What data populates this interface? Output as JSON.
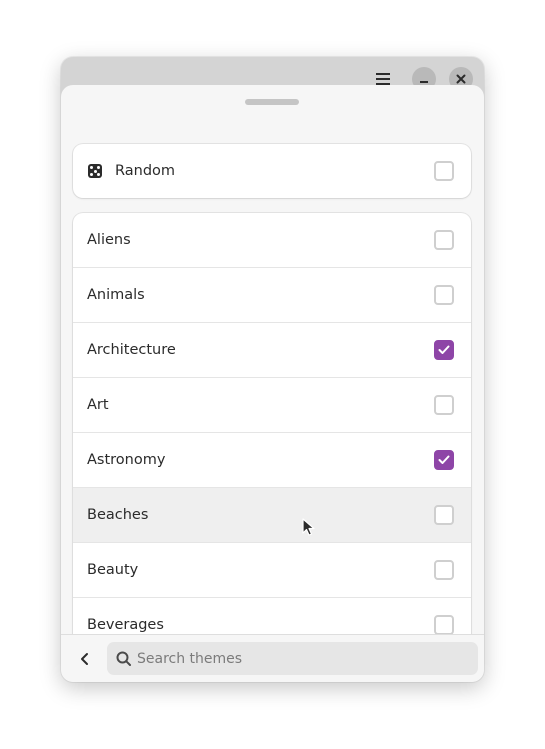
{
  "window": {
    "header": {
      "menu_icon": "hamburger-menu-icon",
      "minimize_icon": "minimize-icon",
      "close_icon": "close-icon"
    }
  },
  "random": {
    "icon": "dice-icon",
    "label": "Random",
    "checked": false
  },
  "themes": [
    {
      "label": "Aliens",
      "checked": false
    },
    {
      "label": "Animals",
      "checked": false
    },
    {
      "label": "Architecture",
      "checked": true
    },
    {
      "label": "Art",
      "checked": false
    },
    {
      "label": "Astronomy",
      "checked": true
    },
    {
      "label": "Beaches",
      "checked": false
    },
    {
      "label": "Beauty",
      "checked": false
    },
    {
      "label": "Beverages",
      "checked": false
    }
  ],
  "footer": {
    "back_icon": "chevron-left-icon",
    "search_icon": "search-icon",
    "search_placeholder": "Search themes",
    "search_value": ""
  },
  "colors": {
    "accent": "#8e45a7"
  }
}
